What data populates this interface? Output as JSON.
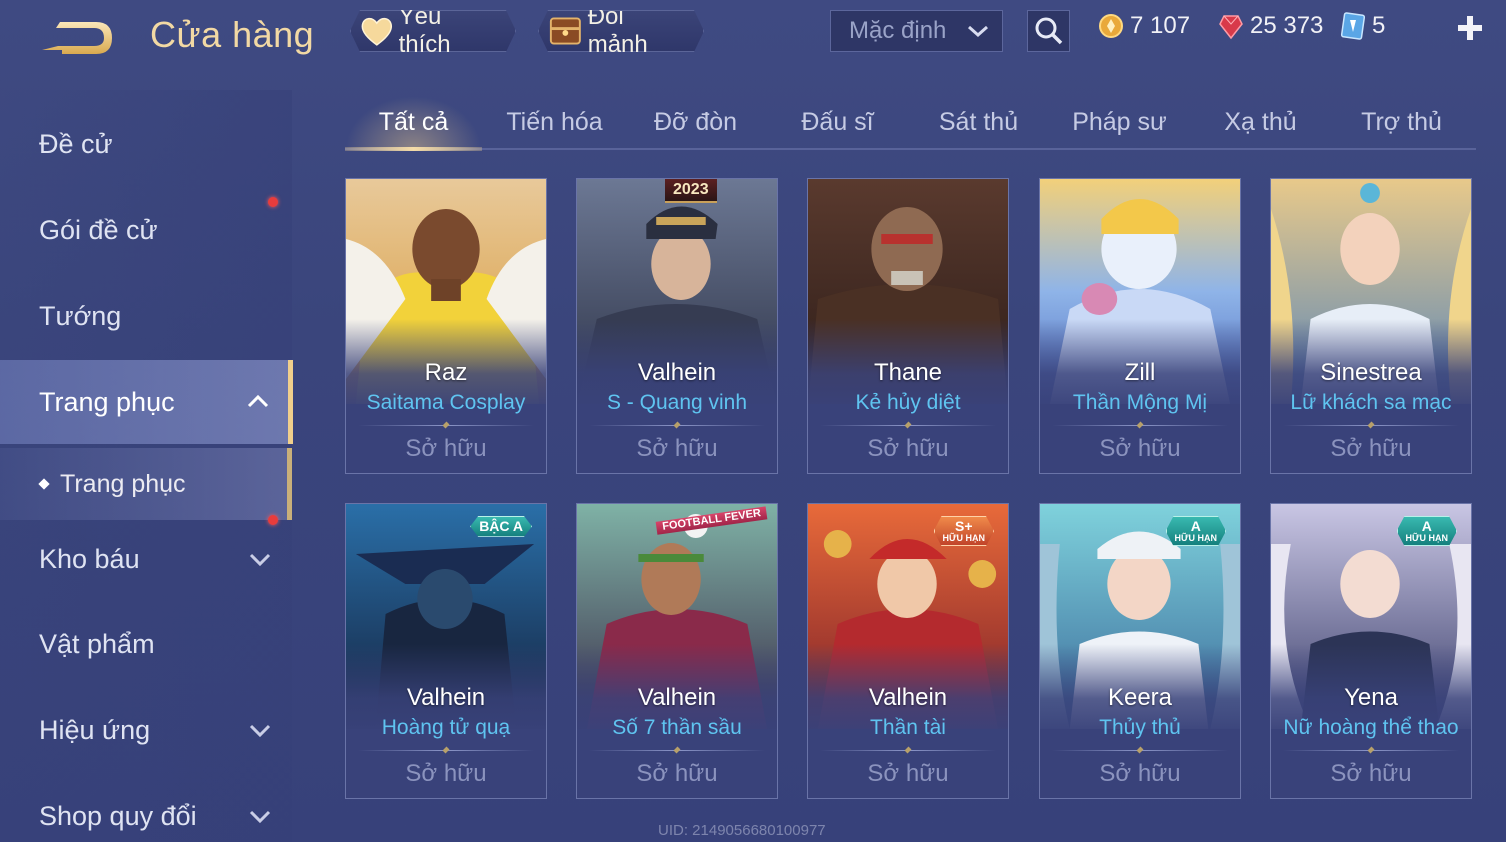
{
  "header": {
    "title": "Cửa hàng",
    "favorites_label": "Yêu thích",
    "exchange_label": "Đổi mảnh",
    "sort": {
      "selected": "Mặc định"
    },
    "currencies": {
      "gold": "7 107",
      "voucher": "25 373",
      "crystal": "5"
    }
  },
  "sidebar": {
    "items": [
      {
        "label": "Đề cử"
      },
      {
        "label": "Gói đề cử"
      },
      {
        "label": "Tướng"
      },
      {
        "label": "Trang phục"
      },
      {
        "label": "Trang phục"
      },
      {
        "label": "Kho báu"
      },
      {
        "label": "Vật phẩm"
      },
      {
        "label": "Hiệu ứng"
      },
      {
        "label": "Shop quy đổi"
      }
    ]
  },
  "tabs": [
    "Tất cả",
    "Tiến hóa",
    "Đỡ đòn",
    "Đấu sĩ",
    "Sát thủ",
    "Pháp sư",
    "Xạ thủ",
    "Trợ thủ"
  ],
  "cards": [
    {
      "hero": "Raz",
      "skin": "Saitama Cosplay",
      "status": "Sở hữu"
    },
    {
      "hero": "Valhein",
      "skin": "S - Quang vinh",
      "status": "Sở hữu",
      "tag": "2023"
    },
    {
      "hero": "Thane",
      "skin": "Kẻ hủy diệt",
      "status": "Sở hữu"
    },
    {
      "hero": "Zill",
      "skin": "Thần Mộng Mị",
      "status": "Sở hữu"
    },
    {
      "hero": "Sinestrea",
      "skin": "Lữ khách sa mạc",
      "status": "Sở hữu"
    },
    {
      "hero": "Valhein",
      "skin": "Hoàng tử quạ",
      "status": "Sở hữu",
      "badge": "BẬC A"
    },
    {
      "hero": "Valhein",
      "skin": "Số 7 thần sầu",
      "status": "Sở hữu",
      "tag": "FOOTBALL FEVER"
    },
    {
      "hero": "Valhein",
      "skin": "Thần tài",
      "status": "Sở hữu",
      "badge": "S+",
      "badge_sub": "HỮU HẠN"
    },
    {
      "hero": "Keera",
      "skin": "Thủy thủ",
      "status": "Sở hữu",
      "badge": "A",
      "badge_sub": "HỮU HẠN"
    },
    {
      "hero": "Yena",
      "skin": "Nữ hoàng thể thao",
      "status": "Sở hữu",
      "badge": "A",
      "badge_sub": "HỮU HẠN"
    }
  ],
  "footer": {
    "uid": "UID: 2149056680100977"
  },
  "colors": {
    "background": "#3b467e",
    "title_gold": "#f2d9a4",
    "skin_name_blue": "#5fc4f0",
    "active_border": "#f0cf8c",
    "notification_red": "#e83c3c"
  },
  "icons": [
    "back-arrow-icon",
    "heart-icon",
    "chest-icon",
    "chevron-down-icon",
    "search-icon",
    "gold-coin-icon",
    "voucher-gem-icon",
    "crystal-card-icon",
    "plus-icon",
    "chevron-up-icon"
  ]
}
